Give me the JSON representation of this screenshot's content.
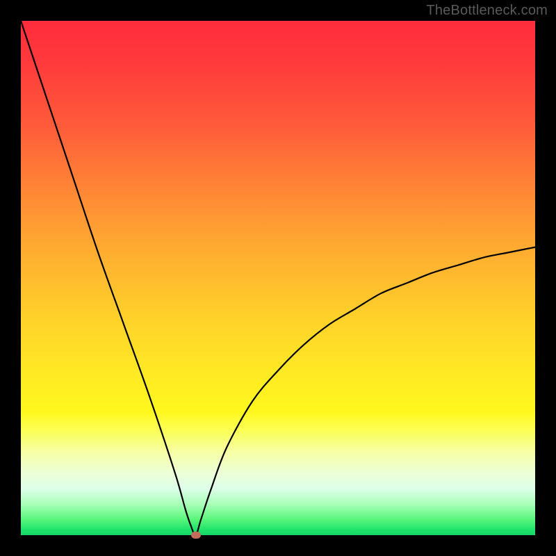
{
  "watermark": {
    "text": "TheBottleneck.com"
  },
  "colors": {
    "frame_bg": "#000000",
    "gradient_top": "#ff2c3c",
    "gradient_bottom": "#18d66a",
    "curve_stroke": "#000000",
    "marker_fill": "#c56b5a"
  },
  "chart_data": {
    "type": "line",
    "title": "",
    "xlabel": "",
    "ylabel": "",
    "xlim": [
      0,
      100
    ],
    "ylim": [
      0,
      100
    ],
    "notes": "Bottleneck-style V-curve. y ≈ 100 means red/bad, y ≈ 0 means green/good. Minimum (optimal match) at x ≈ 34. Left branch climbs to 100 at x=0; right branch approaches ~56 by x=100.",
    "series": [
      {
        "name": "bottleneck_curve",
        "x": [
          0,
          5,
          10,
          15,
          20,
          25,
          30,
          32,
          33,
          34,
          35,
          37,
          40,
          45,
          50,
          55,
          60,
          65,
          70,
          75,
          80,
          85,
          90,
          95,
          100
        ],
        "y": [
          100,
          85,
          70,
          55,
          41,
          27,
          12,
          5,
          2,
          0,
          3,
          9,
          17,
          26,
          32,
          37,
          41,
          44,
          47,
          49,
          51,
          52.5,
          54,
          55,
          56
        ]
      }
    ],
    "marker": {
      "x": 34,
      "y": 0
    }
  }
}
